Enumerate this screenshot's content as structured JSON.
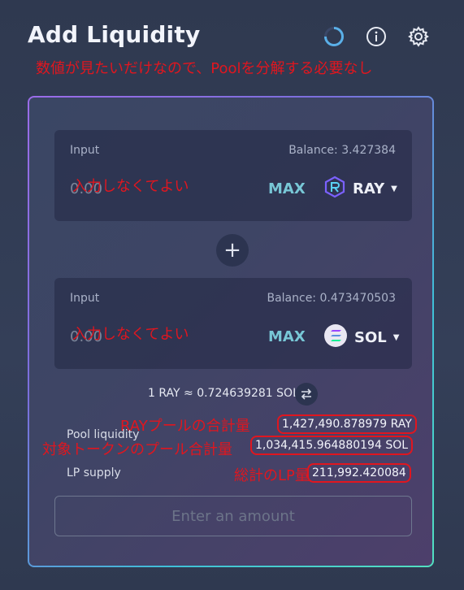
{
  "header": {
    "title": "Add Liquidity",
    "icons": [
      "refresh-spinner-icon",
      "info-icon",
      "settings-gear-icon"
    ]
  },
  "annotation_top": "数値が見たいだけなので、Poolを分解する必要なし",
  "inputs": [
    {
      "label": "Input",
      "balance": "Balance: 3.427384",
      "amount": "0.00",
      "max_label": "MAX",
      "token": "RAY",
      "token_icon": "raydium-logo-icon",
      "annotation": "入力しなくてよい"
    },
    {
      "label": "Input",
      "balance": "Balance: 0.473470503",
      "amount": "0.00",
      "max_label": "MAX",
      "token": "SOL",
      "token_icon": "solana-logo-icon",
      "annotation": "入力しなくてよい"
    }
  ],
  "plus_symbol": "+",
  "rate": "1 RAY ≈ 0.724639281 SOL",
  "pool": {
    "liquidity_label": "Pool liquidity",
    "ray_value": "1,427,490.878979 RAY",
    "sol_value": "1,034,415.964880194 SOL",
    "lp_label": "LP supply",
    "lp_value": "211,992.420084"
  },
  "annotations": {
    "ray_pool": "RAYプールの合計量",
    "target_pool": "対象トークンのプール合計量",
    "lp_total": "総計のLP量"
  },
  "submit_label": "Enter an amount",
  "colors": {
    "annotation_red": "#e0161f",
    "max_teal": "#78c7d6",
    "background": "#343f58"
  }
}
